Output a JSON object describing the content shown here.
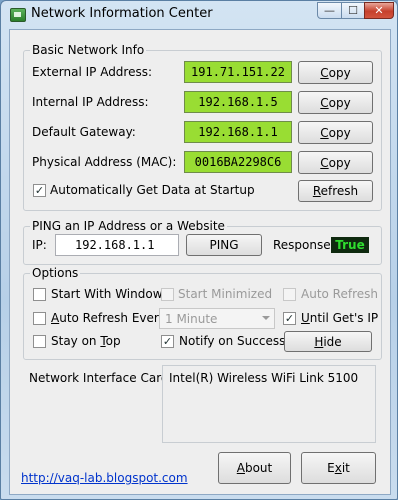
{
  "window": {
    "title": "Network Information Center",
    "buttons": {
      "minimize": "—",
      "maximize": "☐",
      "close": "✕"
    }
  },
  "basic": {
    "legend": "Basic Network Info",
    "rows": [
      {
        "label": "External IP Address:",
        "value": "191.71.151.22",
        "button_pre": "",
        "button_acc": "C",
        "button_post": "opy"
      },
      {
        "label": "Internal IP Address:",
        "value": "192.168.1.5",
        "button_pre": "",
        "button_acc": "C",
        "button_post": "opy"
      },
      {
        "label": "Default Gateway:",
        "value": "192.168.1.1",
        "button_pre": "",
        "button_acc": "C",
        "button_post": "opy"
      },
      {
        "label": "Physical Address (MAC):",
        "value": "0016BA2298C6",
        "button_pre": "",
        "button_acc": "C",
        "button_post": "opy"
      }
    ],
    "auto_get": {
      "label": "Automatically Get Data at Startup",
      "checked": true
    },
    "refresh": {
      "pre": "",
      "acc": "R",
      "post": "efresh"
    }
  },
  "ping": {
    "legend": "PING an IP Address or a Website",
    "ip_label": "IP:",
    "ip_value": "192.168.1.1",
    "button": "PING",
    "response_label": "Response:",
    "response_value": "True"
  },
  "options": {
    "legend": "Options",
    "start_with_windows": {
      "label": "Start With Windows",
      "checked": false
    },
    "start_minimized": {
      "label": "Start Minimized",
      "checked": false,
      "enabled": false
    },
    "auto_refresh_right": {
      "label": "Auto Refresh",
      "checked": false,
      "enabled": false
    },
    "auto_refresh_every": {
      "pre": "",
      "acc": "A",
      "post": "uto Refresh Every:",
      "checked": false
    },
    "interval": {
      "selected": "1 Minute",
      "enabled": false
    },
    "until_gets_ip": {
      "pre": "",
      "acc": "U",
      "post": "ntil Get's IP",
      "checked": true
    },
    "stay_on_top": {
      "pre": "Stay on ",
      "acc": "T",
      "post": "op",
      "checked": false
    },
    "notify": {
      "label": "Notify on Success",
      "checked": true
    },
    "hide": {
      "pre": "",
      "acc": "H",
      "post": "ide"
    }
  },
  "nic": {
    "label": "Network Interface Card:",
    "value": "Intel(R) Wireless WiFi Link 5100"
  },
  "footer": {
    "link": "http://vaq-lab.blogspot.com",
    "about": {
      "pre": "",
      "acc": "A",
      "post": "bout"
    },
    "exit": {
      "pre": "E",
      "acc": "x",
      "post": "it"
    }
  }
}
